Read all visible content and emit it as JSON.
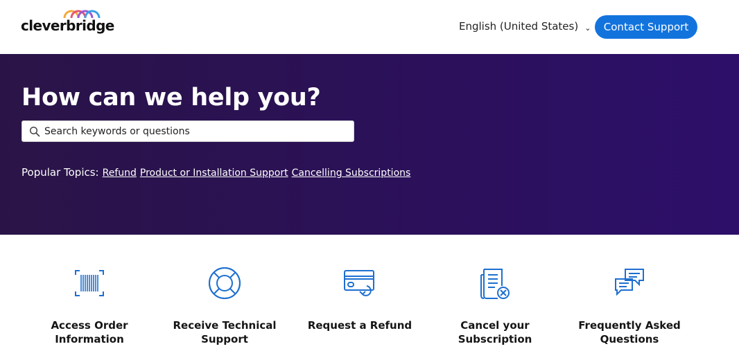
{
  "header": {
    "logo_text": "cleverbridge",
    "language": "English (United States)",
    "contact_label": "Contact Support"
  },
  "hero": {
    "title": "How can we help you?",
    "search_placeholder": "Search keywords or questions",
    "popular_label": "Popular Topics:",
    "topics": [
      "Refund",
      "Product or Installation Support",
      "Cancelling Subscriptions"
    ]
  },
  "cards": [
    {
      "label": "Access Order\nInformation",
      "icon": "barcode-icon"
    },
    {
      "label": "Receive Technical\nSupport",
      "icon": "lifebuoy-icon"
    },
    {
      "label": "Request a Refund",
      "icon": "refund-card-icon"
    },
    {
      "label": "Cancel your\nSubscription",
      "icon": "cancel-document-icon"
    },
    {
      "label": "Frequently Asked\nQuestions",
      "icon": "chat-bubbles-icon"
    }
  ],
  "colors": {
    "accent": "#1273dd",
    "hero_bg": "#2b1156",
    "icon": "#1d6fd0"
  }
}
